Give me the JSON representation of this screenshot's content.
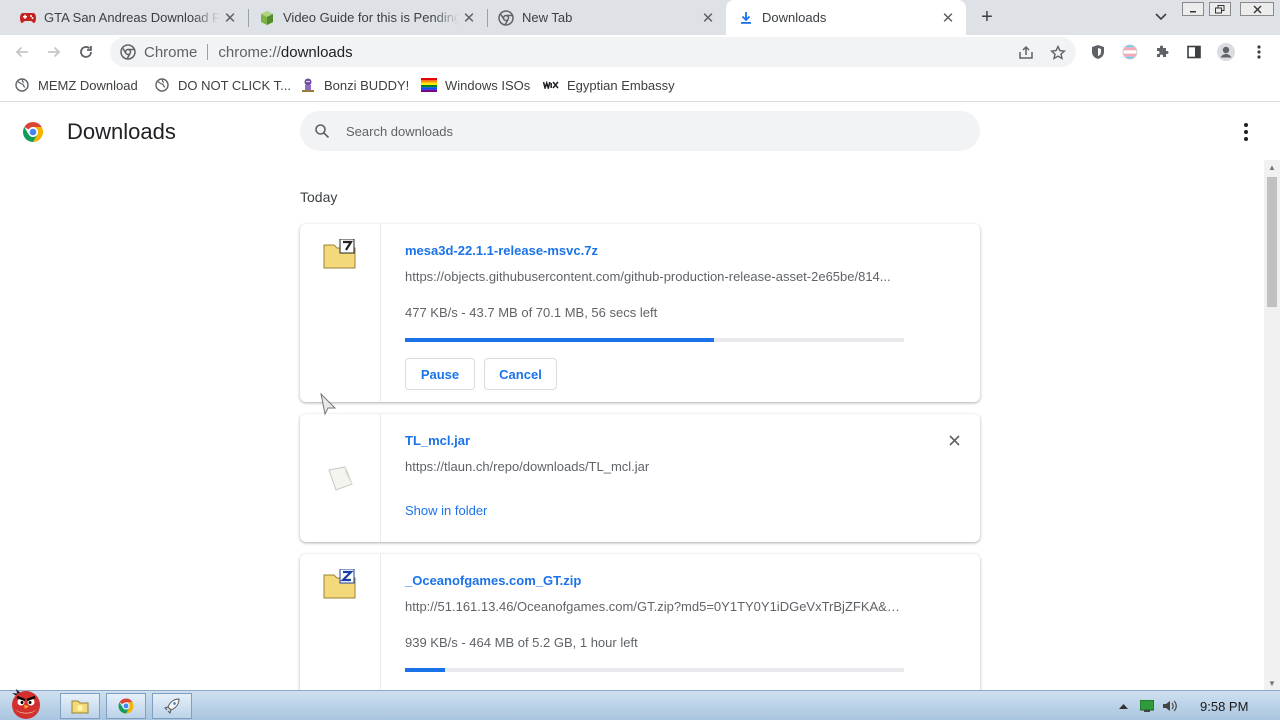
{
  "tabs": [
    {
      "title": "GTA San Andreas Download Fr",
      "icon": "gamepad-icon"
    },
    {
      "title": "Video Guide for this is Pending",
      "icon": "cube-icon"
    },
    {
      "title": "New Tab",
      "icon": "chrome-icon"
    },
    {
      "title": "Downloads",
      "icon": "download-icon",
      "active": true
    }
  ],
  "toolbar": {
    "chip_label": "Chrome",
    "url_prefix": "chrome://",
    "url_path": "downloads"
  },
  "bookmarks": [
    {
      "label": "MEMZ Download",
      "icon": "globe-icon"
    },
    {
      "label": "DO NOT CLICK T...",
      "icon": "globe-icon"
    },
    {
      "label": "Bonzi BUDDY!",
      "icon": "bonzi-icon"
    },
    {
      "label": "Windows ISOs",
      "icon": "rainbow-flag-icon"
    },
    {
      "label": "Egyptian Embassy",
      "icon": "wix-icon"
    }
  ],
  "page": {
    "title": "Downloads",
    "search_placeholder": "Search downloads",
    "date_header": "Today"
  },
  "downloads": [
    {
      "name": "mesa3d-22.1.1-release-msvc.7z",
      "url": "https://objects.githubusercontent.com/github-production-release-asset-2e65be/814...",
      "status": "477 KB/s - 43.7 MB of 70.1 MB, 56 secs left",
      "progress": 0.62,
      "pause_label": "Pause",
      "cancel_label": "Cancel"
    },
    {
      "name": "TL_mcl.jar",
      "url": "https://tlaun.ch/repo/downloads/TL_mcl.jar",
      "action_label": "Show in folder"
    },
    {
      "name": "_Oceanofgames.com_GT.zip",
      "url": "http://51.161.13.46/Oceanofgames.com/GT.zip?md5=0Y1TY0Y1iDGeVxTrBjZFKA&e...",
      "status": "939 KB/s - 464 MB of 5.2 GB, 1 hour left",
      "progress": 0.08
    }
  ],
  "taskbar": {
    "clock": "9:58 PM"
  },
  "colors": {
    "accent": "#1a73e8",
    "tabstrip": "#dee1e6"
  }
}
